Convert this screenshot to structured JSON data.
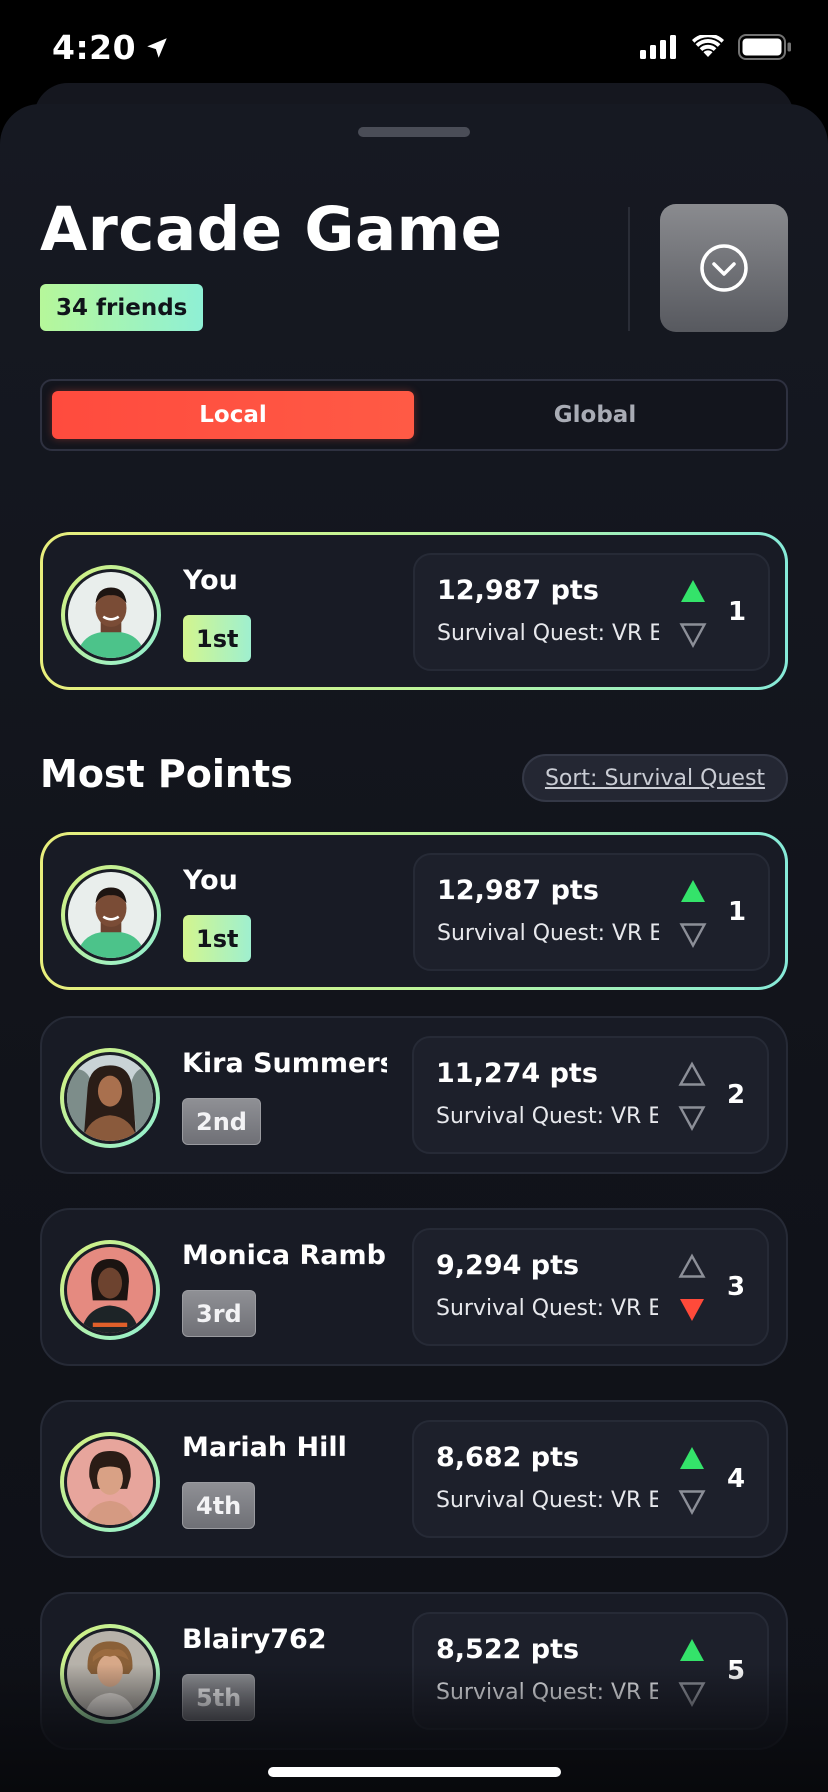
{
  "status_bar": {
    "time": "4:20"
  },
  "header": {
    "title": "Arcade Game",
    "friends_badge": "34 friends"
  },
  "segments": {
    "local": "Local",
    "global": "Global",
    "selected": "Local"
  },
  "current_player": {
    "name": "You",
    "rank": "1st",
    "points": "12,987 pts",
    "game": "Survival Quest: VR Edition",
    "trend": "up",
    "position": "1"
  },
  "section": {
    "title": "Most Points",
    "sort_label": "Sort: Survival Quest"
  },
  "leaderboard": [
    {
      "name": "You",
      "rank": "1st",
      "points": "12,987 pts",
      "game": "Survival Quest: VR Edition",
      "trend": "up",
      "position": "1"
    },
    {
      "name": "Kira Summers",
      "rank": "2nd",
      "points": "11,274 pts",
      "game": "Survival Quest: VR Edition",
      "trend": "none",
      "position": "2"
    },
    {
      "name": "Monica Rambeau",
      "rank": "3rd",
      "points": "9,294 pts",
      "game": "Survival Quest: VR Edition",
      "trend": "down",
      "position": "3"
    },
    {
      "name": "Mariah Hill",
      "rank": "4th",
      "points": "8,682 pts",
      "game": "Survival Quest: VR Edition",
      "trend": "up",
      "position": "4"
    },
    {
      "name": "Blairy762",
      "rank": "5th",
      "points": "8,522 pts",
      "game": "Survival Quest: VR Edition",
      "trend": "up",
      "position": "5"
    }
  ],
  "colors": {
    "accent_red": "#ff4b3e",
    "trend_up": "#34e36a",
    "trend_down": "#ff4a3a",
    "highlight_gradient_start": "#e8ee7c",
    "highlight_gradient_end": "#86ead8"
  },
  "icons": {
    "location": "location-arrow-icon",
    "signal": "cellular-signal-icon",
    "wifi": "wifi-icon",
    "battery": "battery-icon",
    "dropdown": "chevron-down-circle-icon",
    "trend_up": "triangle-up-icon",
    "trend_down": "triangle-down-icon"
  }
}
